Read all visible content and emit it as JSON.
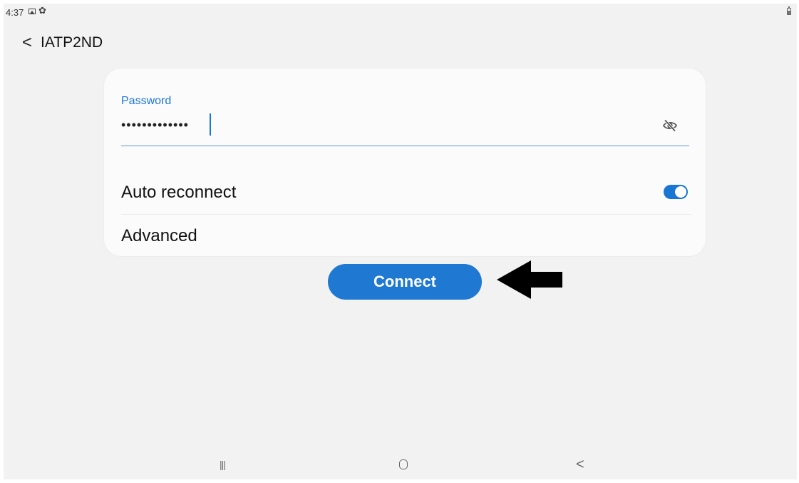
{
  "status_bar": {
    "time": "4:37",
    "icons": [
      "gallery-icon",
      "settings-icon",
      "battery-icon"
    ]
  },
  "header": {
    "back_icon": "chevron-left-icon",
    "back_glyph": "<",
    "title": "IATP2ND"
  },
  "password": {
    "label": "Password",
    "masked_value": "•••••••••••••",
    "visibility_icon": "eye-off-icon"
  },
  "auto_reconnect": {
    "label": "Auto reconnect",
    "enabled": true
  },
  "advanced": {
    "label": "Advanced"
  },
  "connect_button": {
    "label": "Connect"
  },
  "nav_bar": {
    "recents_glyph": "|||",
    "back_glyph": "<"
  },
  "colors": {
    "accent": "#1976d2",
    "button": "#1f78d1",
    "background": "#f2f2f2",
    "card": "#fbfbfb",
    "annotation_arrow": "#000000"
  }
}
